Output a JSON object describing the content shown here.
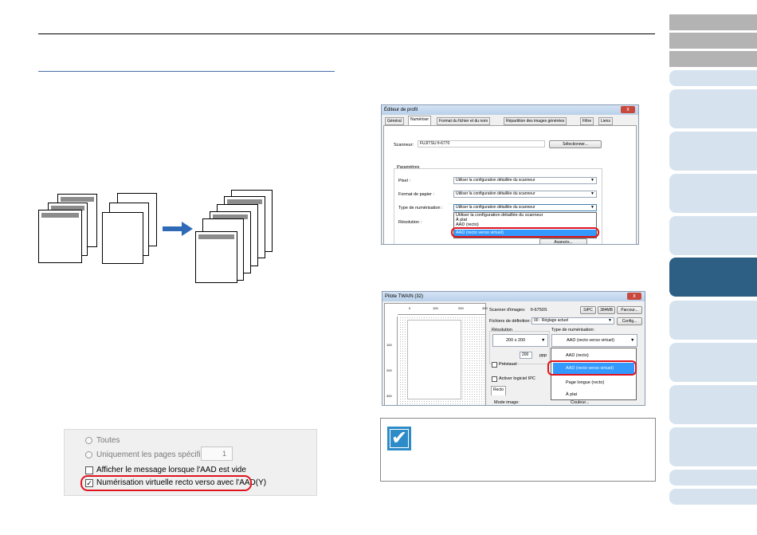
{
  "profile_editor": {
    "title": "Éditeur de profil",
    "close": "x",
    "tabs": [
      "Général",
      "Numériser",
      "Format du fichier et du nom",
      "Répartition des images générées",
      "Filtre",
      "Liens"
    ],
    "scanner_label": "Scanneur:",
    "scanner_value": "FUJITSU fi-6770",
    "select_button": "Sélectionner...",
    "params_label": "Paramètres",
    "pixel_label": "Pixel :",
    "paper_label": "Format de papier :",
    "scan_type_label": "Type de numérisation :",
    "resolution_label": "Résolution :",
    "combo_value": "Utiliser la configuration détaillée du scanneur",
    "dropdown_options": [
      "Utiliser la configuration détaillée du scanneur",
      "À plat",
      "AAD (recto)",
      "AAD (recto verso virtuel)"
    ],
    "advanced_button": "Avancés..."
  },
  "twain": {
    "title": "Pilote TWAIN (32)",
    "ruler_top": [
      "0",
      "100",
      "200",
      "300"
    ],
    "ruler_left": [
      "100",
      "200",
      "300"
    ],
    "scanner_label": "Scanner d'images:",
    "scanner_value": "fi-6750S",
    "sipc": "SIPC",
    "mem": "384MB",
    "browse": "Parcour...",
    "def_file_label": "Fichiers de définition:",
    "def_file_value": "00 : Réglage actuel",
    "config": "Config...",
    "resolution_label": "Résolution",
    "resolution_value": "200 x 200",
    "dpi_value": "200",
    "dpi_unit": "ppp",
    "preview_label": "Prévisuel",
    "activate_label": "Activer logiciel IPC",
    "scan_type_label": "Type de numérisation:",
    "scan_type_value": "AAD (recto verso virtuel)",
    "recto_tab": "Recto",
    "mode_label": "Mode image:",
    "mode_value": "Couleur...",
    "list_items": [
      "AAD (recto)",
      "AAD (recto verso virtuel)",
      "Page longue (recto)",
      "À plat"
    ]
  },
  "options": {
    "all": "Toutes",
    "specified": "Uniquement les pages spécifiées",
    "spin_value": "1",
    "show_message": "Afficher le message lorsque l'AAD est vide",
    "virtual_duplex": "Numérisation virtuelle recto verso avec l'AAD(Y)"
  },
  "colors": {
    "accent_blue": "#2d5f84",
    "tab_light": "#d6e3ef",
    "tab_gray": "#b3b3b3",
    "highlight": "#3399ff",
    "annotation_red": "#e0141e",
    "arrow_blue": "#2e6ab5",
    "note_icon": "#2d8cc8"
  },
  "icons": [
    "checkmark-icon",
    "right-arrow-icon"
  ]
}
